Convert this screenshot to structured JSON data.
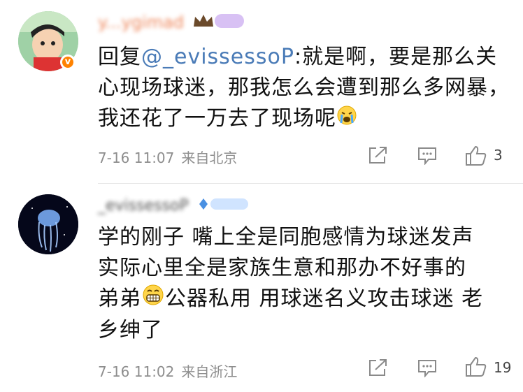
{
  "comments": [
    {
      "username": "y...ygimad",
      "reply_prefix": "回复",
      "mention": "@_evissessoP",
      "text": ":就是啊，要是那么关心现场球迷，那我怎么会遭到那么多网暴，我还花了一万去了现场呢",
      "emoji": "crying-face",
      "time": "7-16 11:07",
      "location": "来自北京",
      "likes": "3"
    },
    {
      "username": "_evissessoP",
      "text_lines": [
        "学的刚子 嘴上全是同胞感情为球迷发声",
        "实际心里全是家族生意和那办不好事的",
        "弟弟",
        "公器私用 用球迷名义攻击球迷 老",
        "乡绅了"
      ],
      "emoji": "grinning-face",
      "time": "7-16 11:02",
      "location": "来自浙江",
      "likes": "19"
    }
  ],
  "colors": {
    "accent": "#eb7340",
    "mention": "#4a7bb7",
    "meta": "#8e8e8e"
  }
}
